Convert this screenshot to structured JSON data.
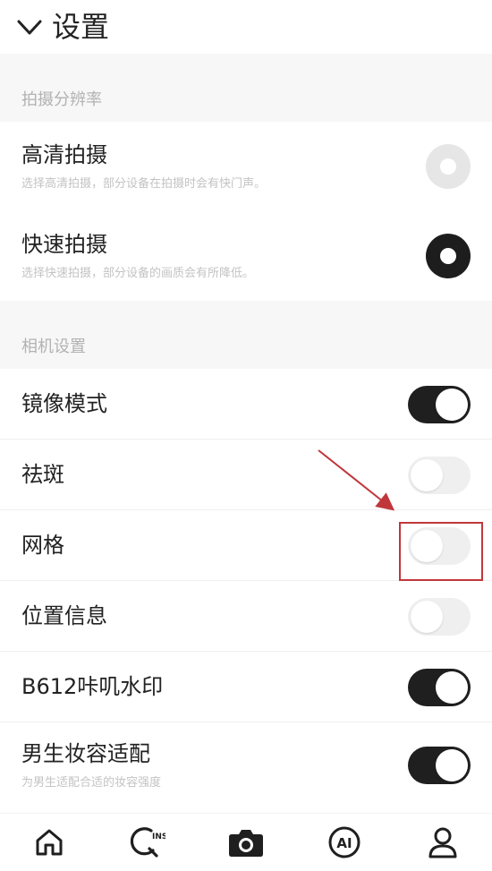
{
  "header": {
    "title": "设置"
  },
  "sections": {
    "resolution": {
      "title": "拍摄分辨率"
    },
    "camera": {
      "title": "相机设置"
    }
  },
  "resolution_options": [
    {
      "label": "高清拍摄",
      "sub": "选择高清拍摄，部分设备在拍摄时会有快门声。",
      "selected": false
    },
    {
      "label": "快速拍摄",
      "sub": "选择快速拍摄，部分设备的画质会有所降低。",
      "selected": true
    }
  ],
  "camera_settings": [
    {
      "label": "镜像模式",
      "on": true
    },
    {
      "label": "祛斑",
      "on": false
    },
    {
      "label": "网格",
      "on": false
    },
    {
      "label": "位置信息",
      "on": false
    },
    {
      "label": "B612咔叽水印",
      "on": true
    },
    {
      "label": "男生妆容适配",
      "sub": "为男生适配合适的妆容强度",
      "on": true
    }
  ],
  "nav": {
    "items": [
      "home-icon",
      "ins-search-icon",
      "camera-icon",
      "ai-icon",
      "profile-icon"
    ],
    "ins_text": "INS",
    "ai_text": "AI"
  },
  "colors": {
    "accent": "#1f1f1f",
    "annotation": "#c0373b",
    "section_bg": "#f7f7f7"
  }
}
